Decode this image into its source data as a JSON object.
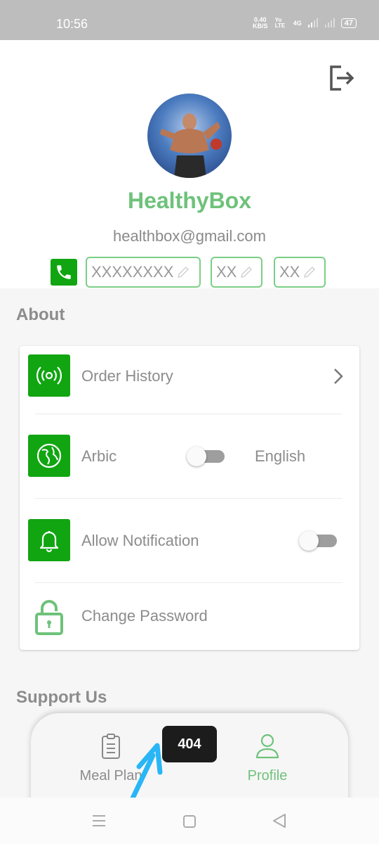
{
  "status": {
    "time": "10:56",
    "net_speed": "0.40 KB/S",
    "volte": "Yo LTE",
    "net": "4G",
    "battery": "47"
  },
  "profile": {
    "name": "HealthyBox",
    "email": "healthbox@gmail.com"
  },
  "phone": {
    "number": "XXXXXXXX",
    "code1": "XX",
    "code2": "XX"
  },
  "about": {
    "title": "About",
    "order_history": "Order History",
    "lang_left": "Arbic",
    "lang_right": "English",
    "notifications": "Allow Notification",
    "change_password": "Change Password"
  },
  "support": {
    "title": "Support Us"
  },
  "nav": {
    "meal_plan": "Meal Plan",
    "profile": "Profile"
  },
  "toast": "404",
  "colors": {
    "accent": "#11a511",
    "name_green": "#6ec27a",
    "text_gray": "#8c8c8c"
  }
}
